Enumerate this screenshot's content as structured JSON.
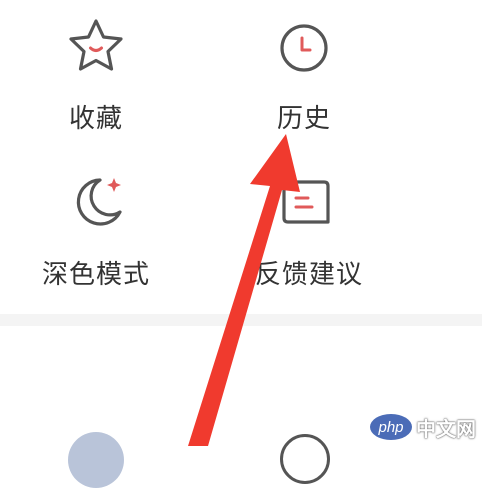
{
  "menu": {
    "items": [
      {
        "label": "收藏",
        "icon": "star-icon"
      },
      {
        "label": "历史",
        "icon": "clock-icon"
      },
      {
        "label": "深色模式",
        "icon": "moon-icon"
      },
      {
        "label": "反馈建议",
        "icon": "feedback-icon"
      }
    ]
  },
  "colors": {
    "icon_stroke": "#555555",
    "icon_accent": "#e05a5a",
    "label_text": "#333333",
    "arrow": "#f03a2e",
    "divider": "#f4f4f4"
  },
  "watermark": {
    "badge": "php",
    "site": "中文网"
  }
}
